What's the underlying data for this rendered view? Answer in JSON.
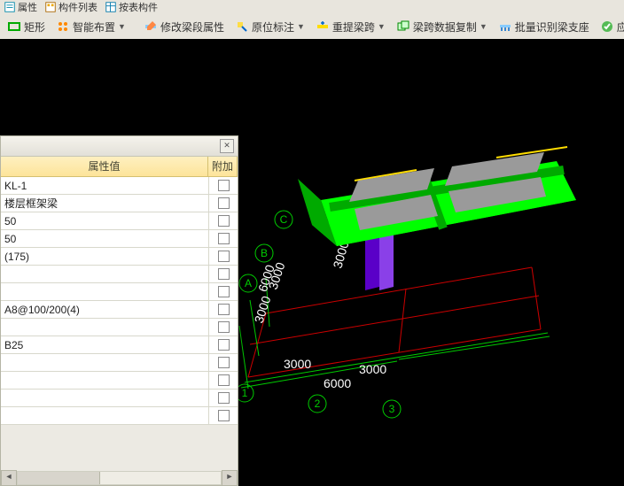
{
  "toolbar_top": {
    "items": [
      "属性",
      "",
      "",
      "构件列表",
      "",
      "按表构件",
      ""
    ]
  },
  "toolbar": {
    "btn1": "矩形",
    "btn2": "智能布置",
    "btn3": "修改梁段属性",
    "btn4": "原位标注",
    "btn5": "重提梁跨",
    "btn6": "梁跨数据复制",
    "btn7": "批量识别梁支座",
    "btn8": "应用"
  },
  "panel": {
    "header_val": "属性值",
    "header_add": "附加",
    "rows": [
      "KL-1",
      "楼层框架梁",
      "50",
      "50",
      "(175)",
      "",
      "",
      "A8@100/200(4)",
      "",
      "B25",
      "",
      "",
      "",
      ""
    ]
  },
  "scene": {
    "axis_letters": [
      "A",
      "B",
      "C"
    ],
    "axis_numbers": [
      "1",
      "2",
      "3"
    ],
    "dim_3000": "3000",
    "dim_6000": "6000"
  }
}
